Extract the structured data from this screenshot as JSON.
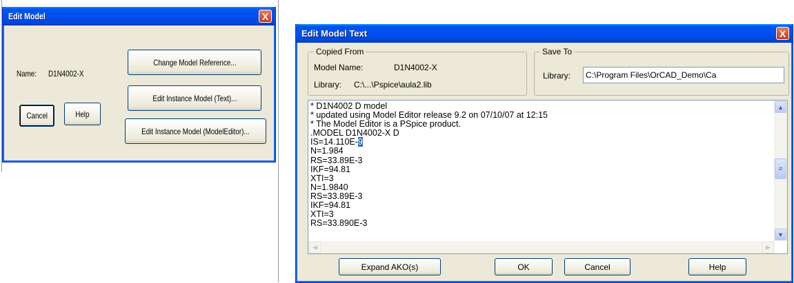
{
  "edit_model": {
    "title": "Edit Model",
    "close_glyph": "X",
    "name_label": "Name:",
    "name_value": "D1N4002-X",
    "change_model_reference": "Change Model Reference...",
    "edit_instance_text": "Edit Instance Model (Text)...",
    "edit_instance_modeleditor": "Edit Instance Model (ModelEditor)...",
    "cancel": "Cancel",
    "help": "Help"
  },
  "edit_model_text": {
    "title": "Edit Model Text",
    "close_glyph": "X",
    "copied_from": {
      "legend": "Copied From",
      "model_name_label": "Model Name:",
      "model_name_value": "D1N4002-X",
      "library_label": "Library:",
      "library_value": "C:\\...\\Pspice\\aula2.lib"
    },
    "save_to": {
      "legend": "Save To",
      "library_label": "Library:",
      "library_value": "C:\\Program Files\\OrCAD_Demo\\Ca"
    },
    "lines": [
      "* D1N4002 D model",
      "* updated using Model Editor release 9.2 on 07/10/07 at 12:15",
      "* The Model Editor is a PSpice product.",
      ".MODEL D1N4002-X D",
      "IS=14.110E-",
      "N=1.984",
      "RS=33.89E-3",
      "IKF=94.81",
      "XTI=3",
      "N=1.9840",
      "RS=33.89E-3",
      "IKF=94.81",
      "XTI=3",
      "RS=33.890E-3"
    ],
    "selected_char": "9",
    "buttons": {
      "expand": "Expand AKO(s)",
      "ok": "OK",
      "cancel": "Cancel",
      "help": "Help"
    },
    "scroll_position": 0.47
  }
}
